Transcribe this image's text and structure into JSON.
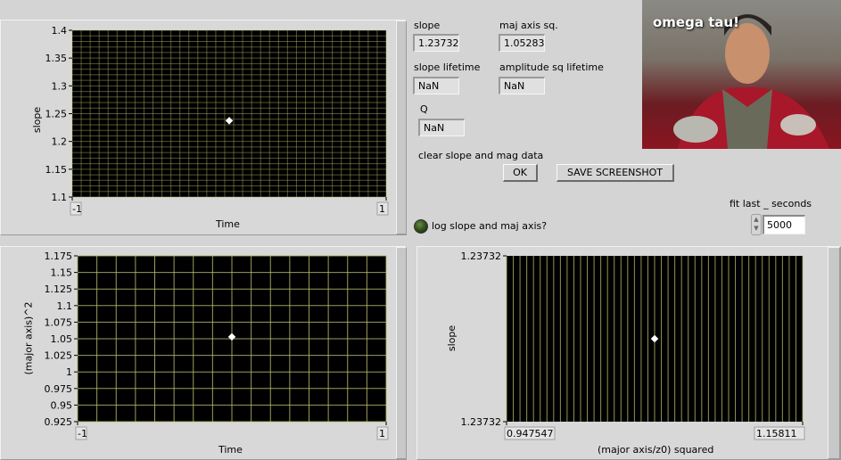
{
  "graph1": {
    "y_label": "slope",
    "x_label": "Time",
    "y_ticks": [
      "1.4",
      "1.35",
      "1.3",
      "1.25",
      "1.2",
      "1.15",
      "1.1"
    ],
    "x_ticks": [
      "-1",
      "1"
    ]
  },
  "graph2": {
    "y_label": "(major axis)^2",
    "x_label": "Time",
    "y_ticks": [
      "1.175",
      "1.15",
      "1.125",
      "1.1",
      "1.075",
      "1.05",
      "1.025",
      "1",
      "0.975",
      "0.95",
      "0.925"
    ],
    "x_ticks": [
      "-1",
      "1"
    ]
  },
  "graph3": {
    "y_label": "slope",
    "x_label": "(major axis/z0) squared",
    "y_ticks": [
      "1.23732",
      "1.23732"
    ],
    "x_ticks": [
      "0.947547",
      "1.15811"
    ]
  },
  "indicators": {
    "slope_label": "slope",
    "slope_value": "1.23732",
    "maj_axis_sq_label": "maj axis sq.",
    "maj_axis_sq_value": "1.05283",
    "slope_lifetime_label": "slope lifetime",
    "slope_lifetime_value": "NaN",
    "amp_sq_lifetime_label": "amplitude sq lifetime",
    "amp_sq_lifetime_value": "NaN",
    "q_label": "Q",
    "q_value": "NaN"
  },
  "controls": {
    "clear_label": "clear slope and mag data",
    "ok_button": "OK",
    "save_button": "SAVE SCREENSHOT",
    "log_label": "log slope and maj axis?",
    "fit_label": "fit last _ seconds",
    "fit_value": "5000"
  },
  "image": {
    "caption": "omega tau!"
  },
  "chart_data": [
    {
      "type": "scatter",
      "x": [
        0
      ],
      "y": [
        1.23732
      ],
      "xlabel": "Time",
      "ylabel": "slope",
      "xlim": [
        -1,
        1
      ],
      "ylim": [
        1.1,
        1.4
      ],
      "grid": true,
      "color": "#ffffff",
      "grid_color": "#b8b86a"
    },
    {
      "type": "scatter",
      "x": [
        0
      ],
      "y": [
        1.05283
      ],
      "xlabel": "Time",
      "ylabel": "(major axis)^2",
      "xlim": [
        -1,
        1
      ],
      "ylim": [
        0.925,
        1.175
      ],
      "grid": true,
      "color": "#ffffff",
      "grid_color": "#b8b86a"
    },
    {
      "type": "scatter",
      "x": [
        1.05283
      ],
      "y": [
        1.23732
      ],
      "xlabel": "(major axis/z0) squared",
      "ylabel": "slope",
      "xlim": [
        0.947547,
        1.15811
      ],
      "ylim": [
        1.23731,
        1.23733
      ],
      "grid": true,
      "color": "#ffffff",
      "grid_color": "#b8b86a"
    }
  ]
}
